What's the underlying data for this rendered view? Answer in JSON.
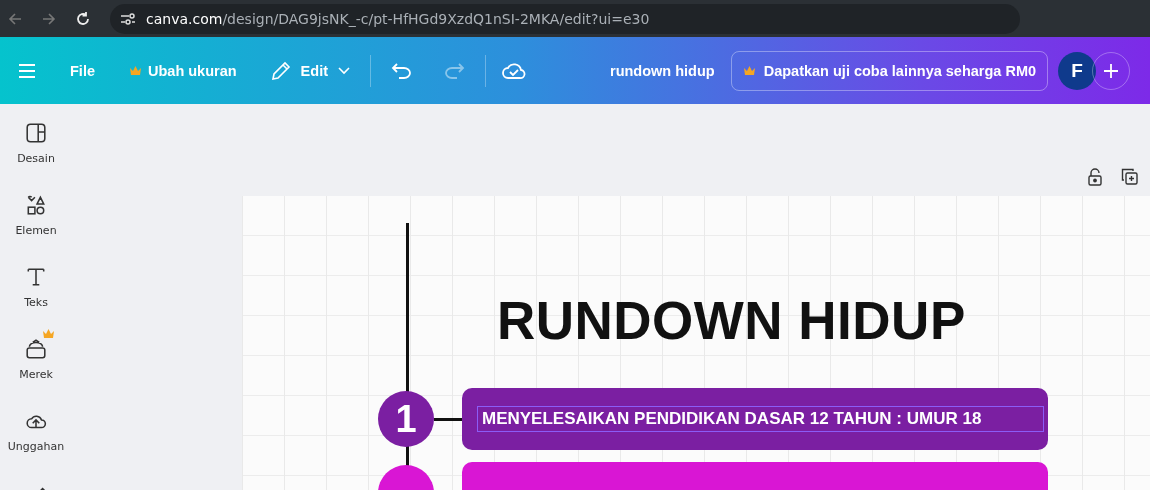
{
  "browser": {
    "url_host": "canva.com",
    "url_path": "/design/DAG9jsNK_-c/pt-HfHGd9XzdQ1nSI-2MKA/edit?ui=e30"
  },
  "toolbar": {
    "menu": [
      {
        "label": "File",
        "kind": "plain"
      },
      {
        "label": "Ubah ukuran",
        "kind": "premium"
      },
      {
        "label": "Edit",
        "kind": "edit"
      }
    ],
    "undo": {
      "disabled": false
    },
    "redo": {
      "disabled": true
    },
    "title": "rundown hidup",
    "upgrade": "Dapatkan uji coba lainnya seharga RM0",
    "avatar": "F"
  },
  "sidebar": {
    "items": [
      {
        "label": "Desain",
        "kind": "layout",
        "premium": false
      },
      {
        "label": "Elemen",
        "kind": "shapes",
        "premium": false
      },
      {
        "label": "Teks",
        "kind": "text",
        "premium": false
      },
      {
        "label": "Merek",
        "kind": "brand",
        "premium": true
      },
      {
        "label": "Unggahan",
        "kind": "upload",
        "premium": false
      }
    ]
  },
  "design": {
    "title": "RUNDOWN HIDUP",
    "steps": [
      {
        "number": "1",
        "text": "MENYELESAIKAN PENDIDIKAN DASAR 12 TAHUN : UMUR 18",
        "color": "#7b1fa2",
        "selected": true
      },
      {
        "color": "#d916d4",
        "selected": false
      }
    ]
  }
}
